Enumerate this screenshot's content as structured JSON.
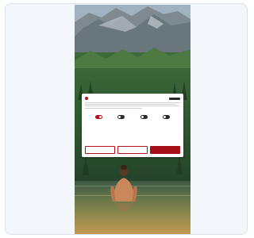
{
  "colors": {
    "card_bg": "#f3f6fa",
    "accent": "#b3121a",
    "accent_dark": "#a50f17",
    "dialog_bg": "#ffffff"
  },
  "background_image": "mountain-lake-person-wading",
  "statusbar": {
    "time": "",
    "icons": ""
  },
  "consent_dialog": {
    "brand_icon": "brand-dot-icon",
    "logo_icon": "site-logo-icon",
    "title": "",
    "body_line_count": 4,
    "privacy_link": "",
    "toggles": [
      {
        "label": "",
        "on": true
      },
      {
        "label": "",
        "on": false
      },
      {
        "label": "",
        "on": false
      },
      {
        "label": "",
        "on": false
      }
    ],
    "more_link": "",
    "buttons": {
      "reject": "",
      "settings": "",
      "accept": ""
    }
  }
}
